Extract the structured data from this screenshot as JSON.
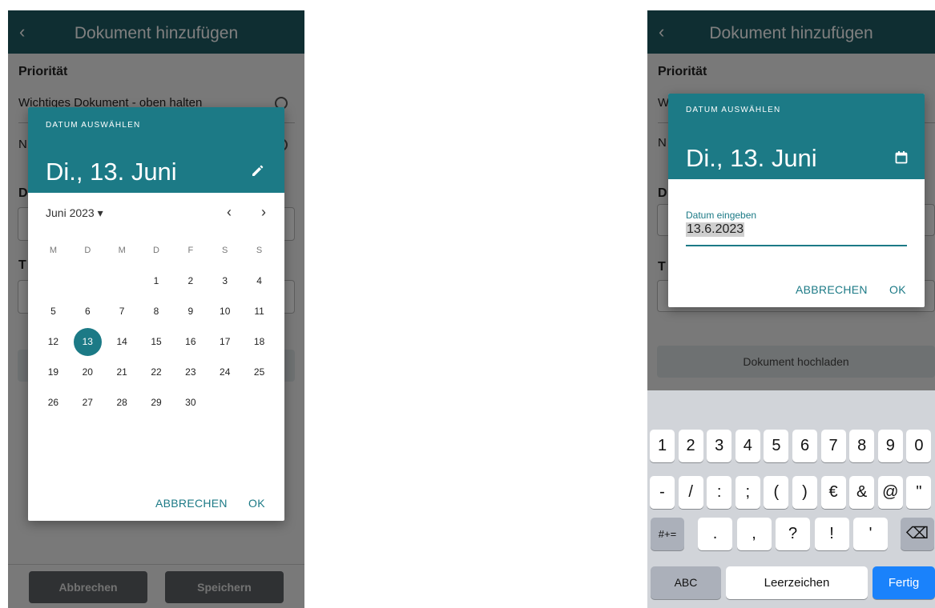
{
  "app": {
    "title": "Dokument hinzufügen",
    "back": "‹"
  },
  "form": {
    "priority_title": "Priorität",
    "priority_option_1": "Wichtiges Dokument - oben halten",
    "priority_option_2_initial": "N",
    "priority_option_1_initial": "W",
    "date_section_initial": "D",
    "title_section_initial": "T",
    "upload_button": "Dokument hochladen"
  },
  "footer": {
    "cancel": "Abbrechen",
    "save": "Speichern"
  },
  "calendar_dialog": {
    "overline": "DATUM AUSWÄHLEN",
    "selected_date": "Di., 13. Juni",
    "month_label": "Juni 2023 ▾",
    "prev": "‹",
    "next": "›",
    "weekdays": [
      "M",
      "D",
      "M",
      "D",
      "F",
      "S",
      "S"
    ],
    "weeks": [
      [
        "",
        "",
        "",
        "1",
        "2",
        "3",
        "4"
      ],
      [
        "5",
        "6",
        "7",
        "8",
        "9",
        "10",
        "11"
      ],
      [
        "12",
        "13",
        "14",
        "15",
        "16",
        "17",
        "18"
      ],
      [
        "19",
        "20",
        "21",
        "22",
        "23",
        "24",
        "25"
      ],
      [
        "26",
        "27",
        "28",
        "29",
        "30",
        "",
        ""
      ]
    ],
    "selected_day": "13",
    "cancel": "ABBRECHEN",
    "ok": "OK"
  },
  "input_dialog": {
    "overline": "DATUM AUSWÄHLEN",
    "selected_date": "Di., 13. Juni",
    "input_label": "Datum eingeben",
    "input_value": "13.6.2023",
    "cancel": "ABBRECHEN",
    "ok": "OK"
  },
  "keyboard": {
    "row1": [
      "1",
      "2",
      "3",
      "4",
      "5",
      "6",
      "7",
      "8",
      "9",
      "0"
    ],
    "row2": [
      "-",
      "/",
      ":",
      ";",
      "(",
      ")",
      "€",
      "&",
      "@",
      "\""
    ],
    "row3_shift": "#+=",
    "row3": [
      ".",
      ",",
      "?",
      "!",
      "'"
    ],
    "backspace": "⌫",
    "abc": "ABC",
    "space": "Leerzeichen",
    "done": "Fertig"
  },
  "colors": {
    "appbar": "#1f5c64",
    "accent": "#1c7a86",
    "keyboard_done": "#1a82fb"
  }
}
